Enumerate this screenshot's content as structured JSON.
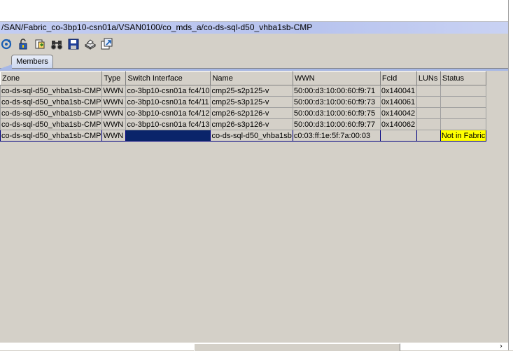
{
  "path_bar": {
    "text": "/SAN/Fabric_co-3bp10-csn01a/VSAN0100/co_mds_a/co-ds-sql-d50_vhba1sb-CMP"
  },
  "toolbar": {
    "buttons": [
      {
        "name": "refresh-button",
        "icon": "refresh-icon"
      },
      {
        "name": "lock-button",
        "icon": "lock-icon"
      },
      {
        "name": "export-button",
        "icon": "export-icon"
      },
      {
        "name": "find-button",
        "icon": "binoculars-icon"
      },
      {
        "name": "save-button",
        "icon": "floppy-disk-icon"
      },
      {
        "name": "print-button",
        "icon": "printer-icon"
      },
      {
        "name": "detach-button",
        "icon": "detach-icon"
      }
    ]
  },
  "tabs": [
    {
      "label": "Members",
      "active": true
    }
  ],
  "table": {
    "columns": [
      "Zone",
      "Type",
      "Switch Interface",
      "Name",
      "WWN",
      "FcId",
      "LUNs",
      "Status"
    ],
    "rows": [
      [
        "co-ds-sql-d50_vhba1sb-CMP",
        "WWN",
        "co-3bp10-csn01a fc4/10",
        "cmp25-s2p125-v",
        "50:00:d3:10:00:60:f9:71",
        "0x140041",
        "",
        ""
      ],
      [
        "co-ds-sql-d50_vhba1sb-CMP",
        "WWN",
        "co-3bp10-csn01a fc4/11",
        "cmp25-s3p125-v",
        "50:00:d3:10:00:60:f9:73",
        "0x140061",
        "",
        ""
      ],
      [
        "co-ds-sql-d50_vhba1sb-CMP",
        "WWN",
        "co-3bp10-csn01a fc4/12",
        "cmp26-s2p126-v",
        "50:00:d3:10:00:60:f9:75",
        "0x140042",
        "",
        ""
      ],
      [
        "co-ds-sql-d50_vhba1sb-CMP",
        "WWN",
        "co-3bp10-csn01a fc4/13",
        "cmp26-s3p126-v",
        "50:00:d3:10:00:60:f9:77",
        "0x140062",
        "",
        ""
      ],
      [
        "co-ds-sql-d50_vhba1sb-CMP",
        "WWN",
        "",
        "co-ds-sql-d50_vhba1sb",
        "c0:03:ff:1e:5f:7a:00:03",
        "",
        "",
        "Not in Fabric"
      ]
    ],
    "selected_row": 4
  },
  "colors": {
    "selection_bg": "#0a246a",
    "status_warning_bg": "#ffff00",
    "path_bar_bg": "#b7c3ee"
  }
}
